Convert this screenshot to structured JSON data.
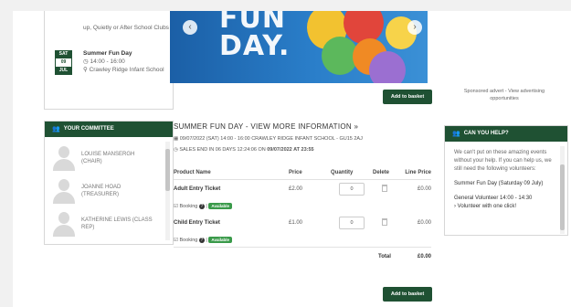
{
  "events": {
    "prev_text": "up, Quietly or After School Clubs",
    "date": {
      "dow": "SAT",
      "day": "09",
      "month": "JUL"
    },
    "title": "Summer Fun Day",
    "time": "14:00 - 16:00",
    "location": "Crawley Ridge Infant School"
  },
  "committee": {
    "heading": "YOUR COMMITTEE",
    "members": [
      {
        "name": "LOUISE MANSERGH (CHAIR)"
      },
      {
        "name": "JOANNE HOAD (TREASURER)"
      },
      {
        "name": "KATHERINE LEWIS (CLASS REP)"
      }
    ]
  },
  "banner": {
    "text_line1": "FUN",
    "text_line2": "DAY."
  },
  "add_basket_label": "Add to basket",
  "event_info": {
    "title": "SUMMER FUN DAY - VIEW MORE INFORMATION »",
    "details": "09/07/2022 (SAT) 14:00 - 16:00 CRAWLEY RIDGE INFANT SCHOOL - GU15 2AJ",
    "sales_end_prefix": "SALES END IN 06 DAYS 12:24:06 ON",
    "sales_end_date": "09/07/2022 AT 23:55"
  },
  "tickets_table": {
    "headers": {
      "product": "Product Name",
      "price": "Price",
      "qty": "Quantity",
      "delete": "Delete",
      "line": "Line Price"
    },
    "rows": [
      {
        "name": "Adult Entry Ticket",
        "price": "£2.00",
        "qty": "0",
        "line_price": "£0.00",
        "booking": "Booking",
        "status": "Available"
      },
      {
        "name": "Child Entry Ticket",
        "price": "£1.00",
        "qty": "0",
        "line_price": "£0.00",
        "booking": "Booking",
        "status": "Available"
      }
    ],
    "total_label": "Total",
    "total_value": "£0.00"
  },
  "sponsor": {
    "text": "Sponsored advert - View advertising opportunities"
  },
  "help": {
    "heading": "CAN YOU HELP?",
    "intro": "We can't put on these amazing events without your help. If you can help us, we still need the following volunteers:",
    "event": "Summer Fun Day (Saturday 09 July)",
    "slot": "General Volunteer 14:00 - 14:30",
    "cta": "Volunteer with one click!"
  },
  "colors": {
    "brand_green": "#1f5133",
    "available_green": "#3a9a4a",
    "banner_blue": "#2a7ec9"
  }
}
